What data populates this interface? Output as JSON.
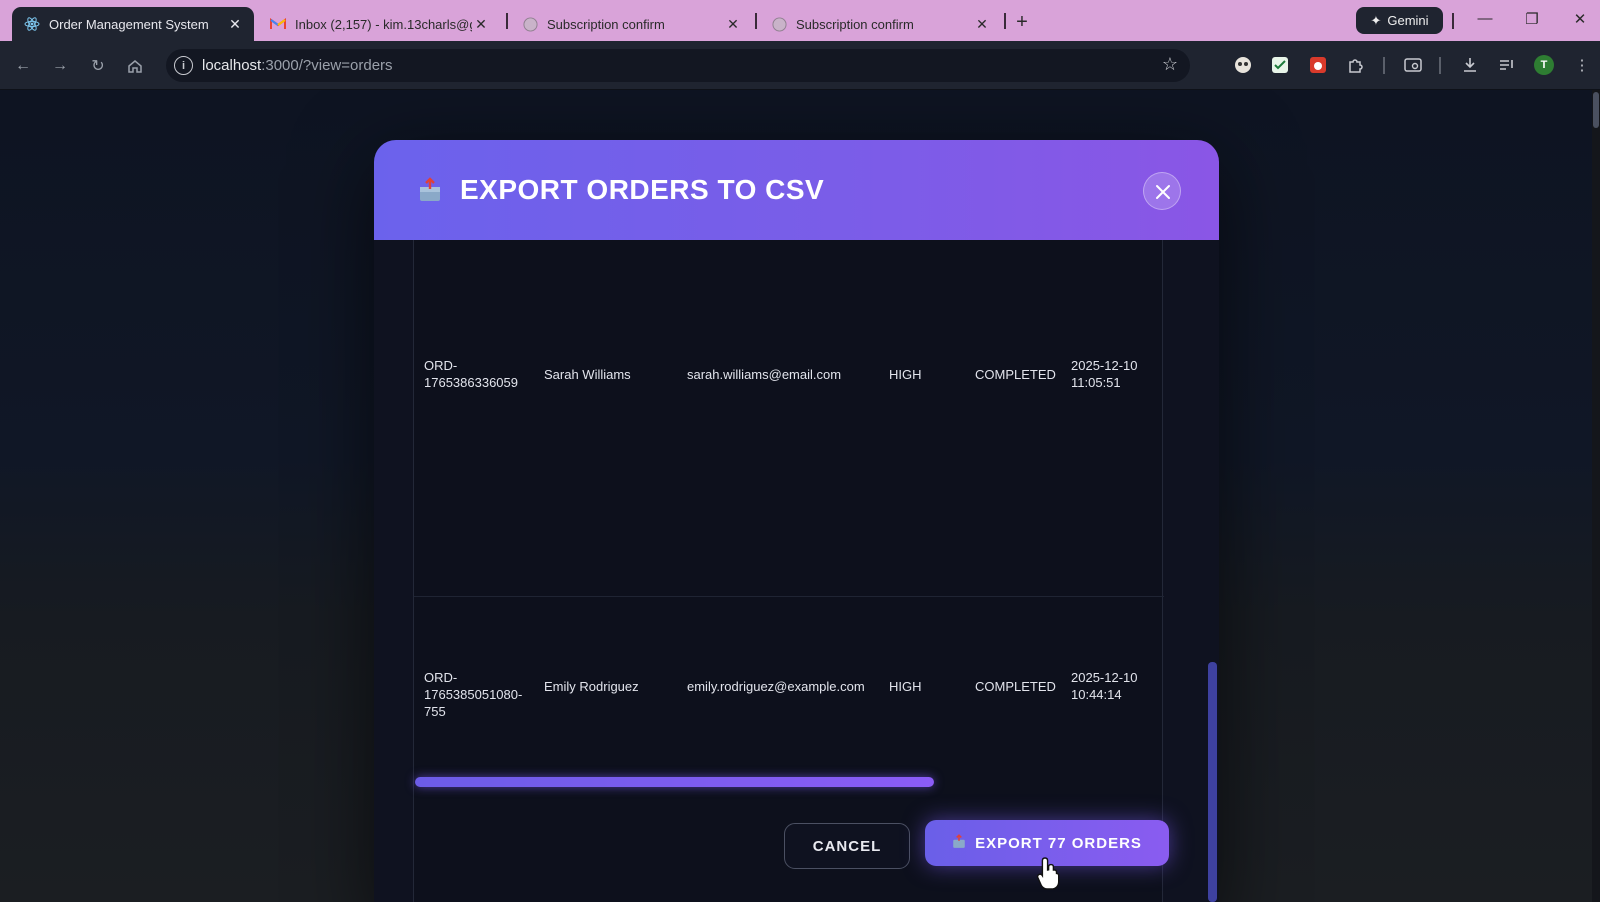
{
  "browser": {
    "tabs": [
      {
        "title": "Order Management System",
        "active": true,
        "favicon": "react-icon"
      },
      {
        "title": "Inbox (2,157) - kim.13charls@g",
        "active": false,
        "favicon": "gmail-icon"
      },
      {
        "title": "Subscription confirm",
        "active": false,
        "favicon": "globe-icon"
      },
      {
        "title": "Subscription confirm",
        "active": false,
        "favicon": "globe-icon"
      }
    ],
    "gemini_label": "Gemini",
    "url_host": "localhost",
    "url_rest": ":3000/?view=orders",
    "profile_initial": "T"
  },
  "modal": {
    "title": "EXPORT ORDERS TO CSV",
    "rows": [
      {
        "order_id": [
          "ORD-",
          "1765386336059"
        ],
        "customer": "Sarah Williams",
        "email": "sarah.williams@email.com",
        "priority": "HIGH",
        "status": "COMPLETED",
        "date": [
          "2025-12-10",
          "11:05:51"
        ]
      },
      {
        "order_id": [
          "ORD-",
          "1765385051080-",
          "755"
        ],
        "customer": "Emily Rodriguez",
        "email": "emily.rodriguez@example.com",
        "priority": "HIGH",
        "status": "COMPLETED",
        "date": [
          "2025-12-10",
          "10:44:14"
        ]
      }
    ],
    "cancel_label": "CANCEL",
    "export_label": "EXPORT 77 ORDERS"
  },
  "colors": {
    "accent": "#6b62ec",
    "accent_end": "#8a56e6",
    "tab_strip": "#d9a3d9",
    "modal_bg": "#0f1220"
  }
}
